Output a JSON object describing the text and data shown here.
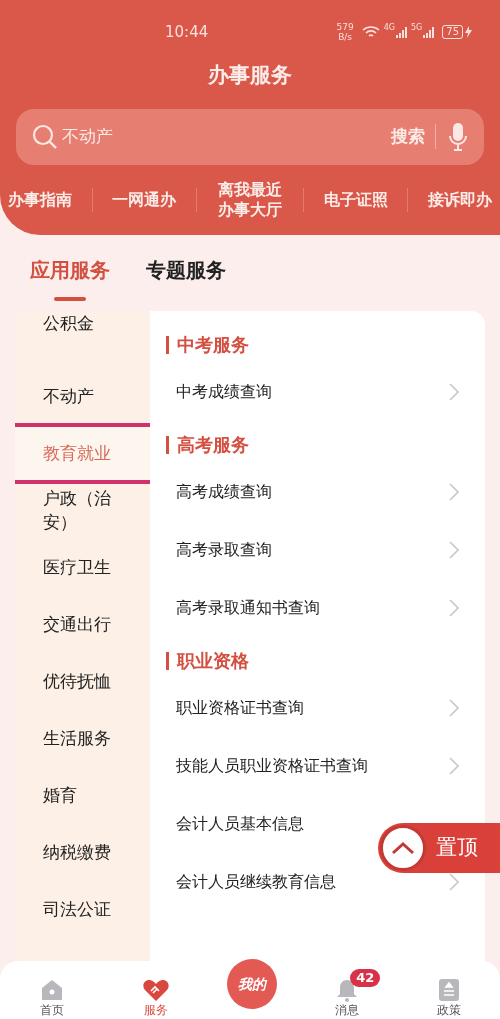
{
  "status_bar": {
    "time": "10:44",
    "net_speed": "579\nB/s",
    "network_1": "4G",
    "network_2": "5G",
    "battery": "75"
  },
  "header": {
    "title": "办事服务"
  },
  "search": {
    "value": "不动产",
    "button": "搜索"
  },
  "quick_links": [
    "办事指南",
    "一网通办",
    "离我最近办事大厅",
    "电子证照",
    "接诉即办"
  ],
  "tabs": [
    {
      "label": "应用服务",
      "selected": true
    },
    {
      "label": "专题服务",
      "selected": false
    }
  ],
  "categories": [
    {
      "label": "公积金",
      "selected": false
    },
    {
      "label": "不动产",
      "selected": false
    },
    {
      "label": "教育就业",
      "selected": true,
      "highlighted": true
    },
    {
      "label": "户政（治安）",
      "selected": false
    },
    {
      "label": "医疗卫生",
      "selected": false
    },
    {
      "label": "交通出行",
      "selected": false
    },
    {
      "label": "优待抚恤",
      "selected": false
    },
    {
      "label": "生活服务",
      "selected": false
    },
    {
      "label": "婚育",
      "selected": false
    },
    {
      "label": "纳税缴费",
      "selected": false
    },
    {
      "label": "司法公证",
      "selected": false
    }
  ],
  "sections": [
    {
      "title": "中考服务",
      "items": [
        {
          "label": "中考成绩查询",
          "chevron": true
        }
      ]
    },
    {
      "title": "高考服务",
      "items": [
        {
          "label": "高考成绩查询",
          "chevron": true
        },
        {
          "label": "高考录取查询",
          "chevron": true
        },
        {
          "label": "高考录取通知书查询",
          "chevron": true
        }
      ]
    },
    {
      "title": "职业资格",
      "items": [
        {
          "label": "职业资格证书查询",
          "chevron": true
        },
        {
          "label": "技能人员职业资格证书查询",
          "chevron": true
        },
        {
          "label": "会计人员基本信息",
          "chevron": false
        },
        {
          "label": "会计人员继续教育信息",
          "chevron": true
        }
      ]
    }
  ],
  "back_to_top": "置顶",
  "bottom_nav": [
    {
      "kind": "home",
      "label": "首页",
      "selected": false
    },
    {
      "kind": "service",
      "label": "服务",
      "selected": true
    },
    {
      "kind": "center",
      "label": "我的",
      "selected": false
    },
    {
      "kind": "message",
      "label": "消息",
      "selected": false,
      "badge": "42"
    },
    {
      "kind": "policy",
      "label": "政策",
      "selected": false
    }
  ]
}
